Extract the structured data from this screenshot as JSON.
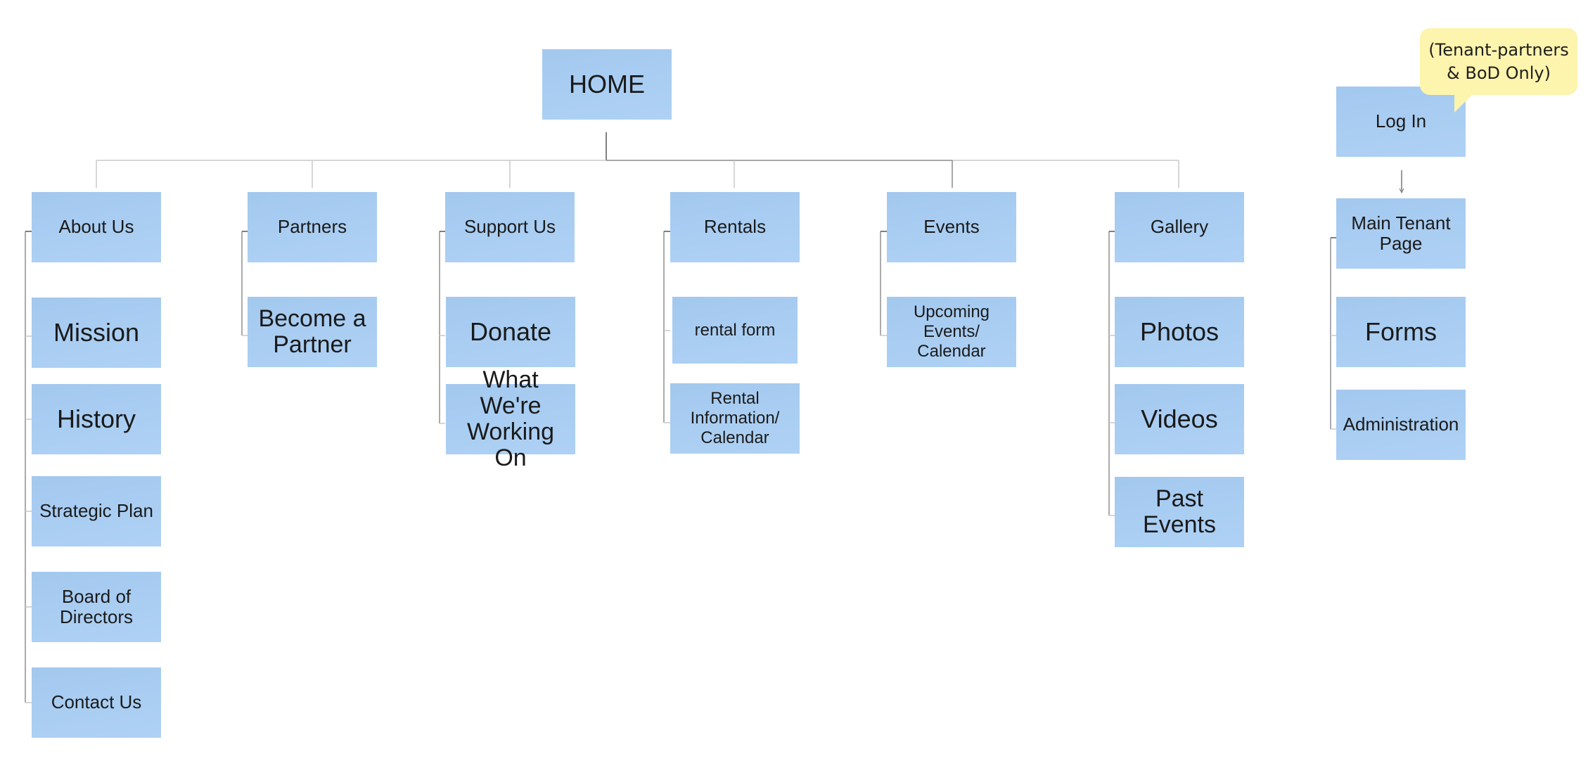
{
  "diagram": {
    "type": "sitemap",
    "root": {
      "label": "HOME"
    },
    "sections": [
      {
        "label": "About Us",
        "children": [
          "Mission",
          "History",
          "Strategic Plan",
          "Board of\nDirectors",
          "Contact Us"
        ]
      },
      {
        "label": "Partners",
        "children": [
          "Become a\nPartner"
        ]
      },
      {
        "label": "Support Us",
        "children": [
          "Donate",
          "What We're\nWorking On"
        ]
      },
      {
        "label": "Rentals",
        "children": [
          "rental form",
          "Rental\nInformation/\nCalendar"
        ]
      },
      {
        "label": "Events",
        "children": [
          "Upcoming\nEvents/\nCalendar"
        ]
      },
      {
        "label": "Gallery",
        "children": [
          "Photos",
          "Videos",
          "Past\nEvents"
        ]
      }
    ],
    "login": {
      "label": "Log In",
      "callout": "(Tenant-partners\n& BoD Only)",
      "children": [
        "Main Tenant\nPage",
        "Forms",
        "Administration"
      ]
    }
  },
  "colors": {
    "note_fill": "#a9cdf2",
    "callout_fill": "#fdf4ad",
    "connector_dark": "#555555",
    "connector_light": "#c8c8c8"
  }
}
